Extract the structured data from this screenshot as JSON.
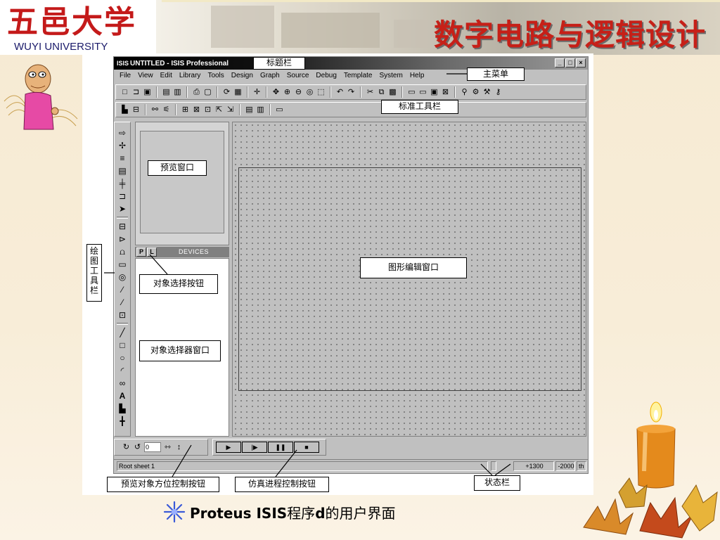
{
  "slide": {
    "university_cn": "五邑大学",
    "university_en": "WUYI UNIVERSITY",
    "course_title": "数字电路与逻辑设计",
    "caption_prefix": "Proteus ISIS",
    "caption_mid": "程序",
    "caption_bold": "d",
    "caption_suffix": "的用户界面"
  },
  "window": {
    "icon_label": "ISIS",
    "title": "UNTITLED - ISIS Professional",
    "btn_minimize": "_",
    "btn_maximize": "□",
    "btn_close": "×"
  },
  "menu": [
    "File",
    "View",
    "Edit",
    "Library",
    "Tools",
    "Design",
    "Graph",
    "Source",
    "Debug",
    "Template",
    "System",
    "Help"
  ],
  "panel": {
    "p_btn": "P",
    "l_btn": "L",
    "devices_title": "DEVICES"
  },
  "rotation": {
    "value": "0"
  },
  "status": {
    "sheet": "Root sheet 1",
    "x": "+1300",
    "y": "-2000",
    "unit": "th"
  },
  "callouts": {
    "title_bar": "标题栏",
    "main_menu": "主菜单",
    "standard_toolbar": "标准工具栏",
    "preview_window": "预览窗口",
    "drawing_toolbar": "绘图工具栏",
    "object_select_button": "对象选择按钮",
    "object_selector_window": "对象选择器窗口",
    "edit_window": "图形编辑窗口",
    "preview_orientation": "预览对象方位控制按钮",
    "sim_control": "仿真进程控制按钮",
    "status_bar": "状态栏"
  }
}
